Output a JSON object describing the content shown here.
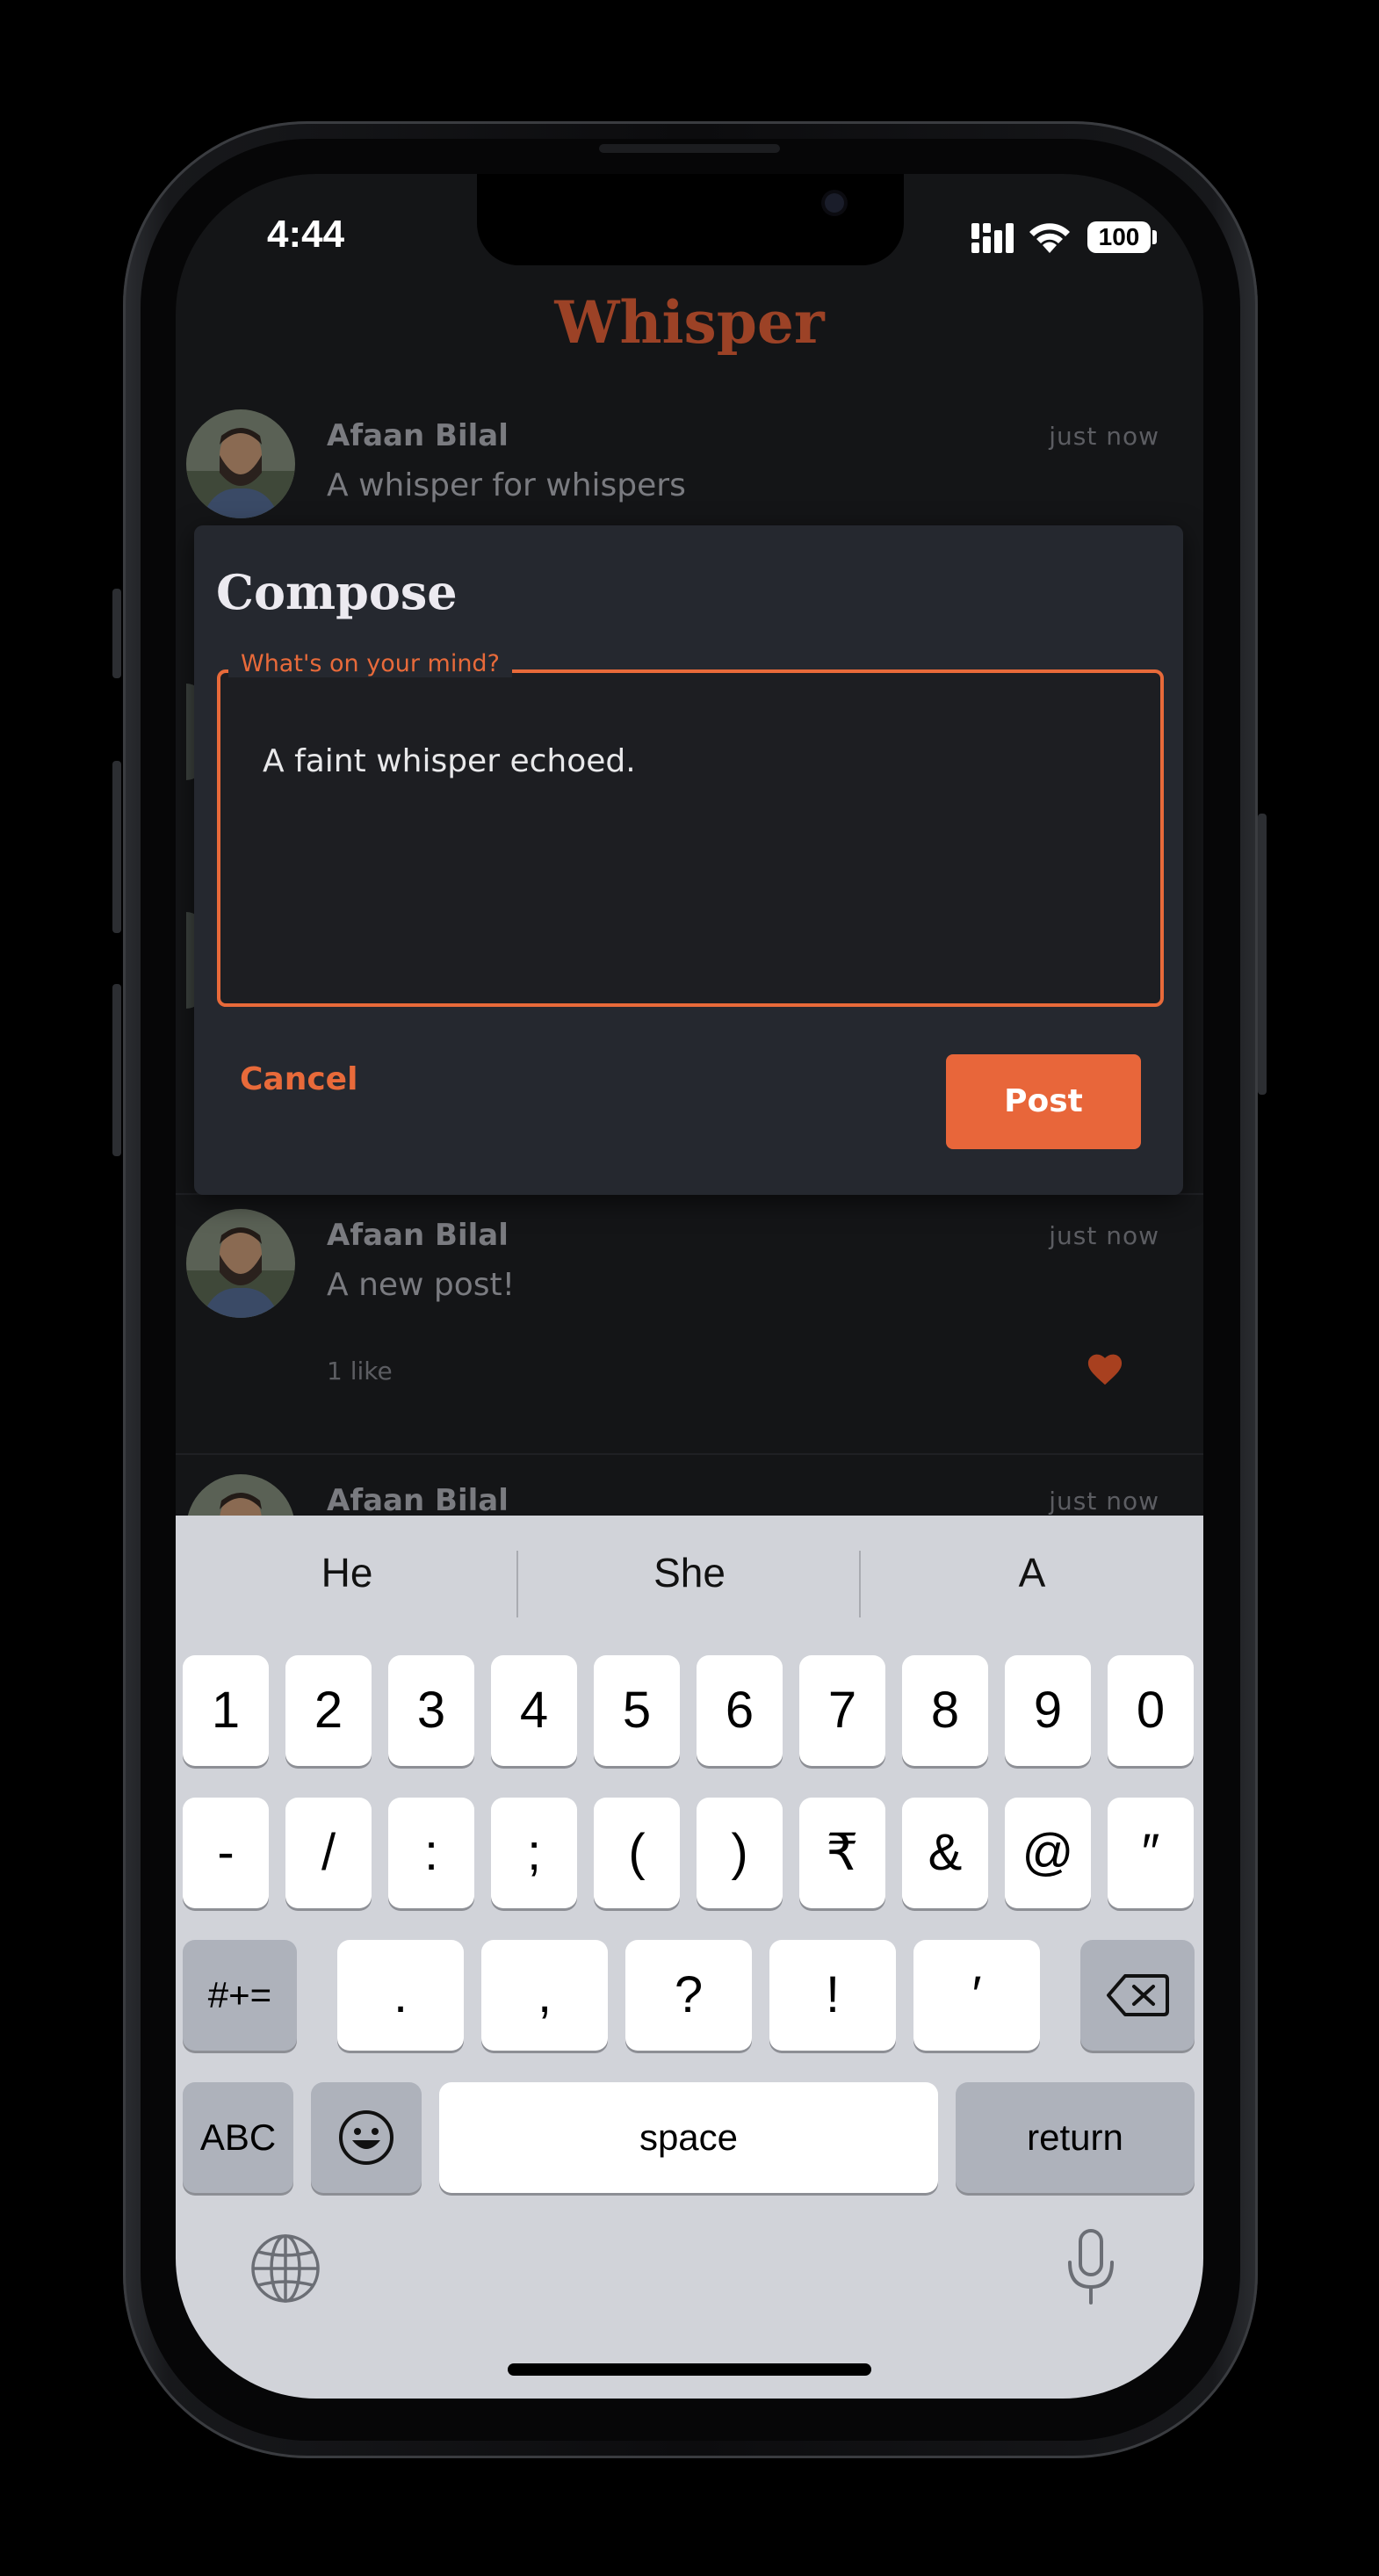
{
  "status_bar": {
    "time": "4:44",
    "battery": "100"
  },
  "app": {
    "title": "Whisper"
  },
  "posts": [
    {
      "author": "Afaan Bilal",
      "time": "just now",
      "text": "A whisper for whispers"
    },
    {
      "author": "Afaan Bilal",
      "time": "just now",
      "text": "A new post!",
      "likes": "1 like"
    },
    {
      "author": "Afaan Bilal",
      "time": "just now"
    }
  ],
  "dialog": {
    "title": "Compose",
    "field_label": "What's on your mind?",
    "field_value": "A faint whisper echoed.",
    "cancel": "Cancel",
    "post": "Post"
  },
  "keyboard": {
    "suggestions": [
      "He",
      "She",
      "A"
    ],
    "row1": [
      "1",
      "2",
      "3",
      "4",
      "5",
      "6",
      "7",
      "8",
      "9",
      "0"
    ],
    "row2": [
      "-",
      "/",
      ":",
      ";",
      "(",
      ")",
      "₹",
      "&",
      "@",
      "″"
    ],
    "row3": [
      ".",
      ",",
      "?",
      "!",
      "′"
    ],
    "symbols_toggle": "#+=",
    "abc": "ABC",
    "space": "space",
    "return": "return"
  },
  "colors": {
    "accent": "#e8663a",
    "title": "#9c4226",
    "background": "#141517",
    "dialog": "#25282f"
  }
}
